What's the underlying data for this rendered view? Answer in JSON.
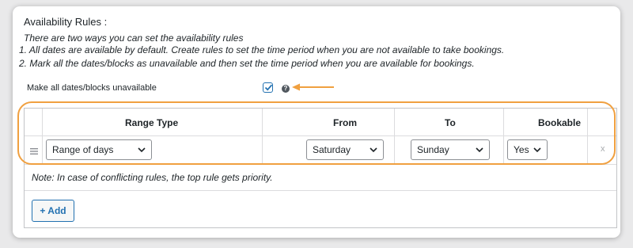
{
  "section": {
    "title": "Availability Rules :",
    "intro": "There are two ways you can set the availability rules",
    "rule1": "1. All dates are available by default. Create rules to set the time period when you are not available to take bookings.",
    "rule2": "2. Mark all the dates/blocks as unavailable and then set the time period when you are available for bookings."
  },
  "option": {
    "label": "Make all dates/blocks unavailable",
    "checked": true,
    "help_icon": "question-circle-icon"
  },
  "table": {
    "headers": [
      "Range Type",
      "From",
      "To",
      "Bookable"
    ],
    "rows": [
      {
        "range_type": "Range of days",
        "from": "Saturday",
        "to": "Sunday",
        "bookable": "Yes",
        "remove": "x"
      }
    ],
    "note": "Note: In case of conflicting rules, the top rule gets priority.",
    "add_label": "+ Add"
  },
  "colors": {
    "highlight": "#f0a040",
    "accent": "#2271b1"
  }
}
